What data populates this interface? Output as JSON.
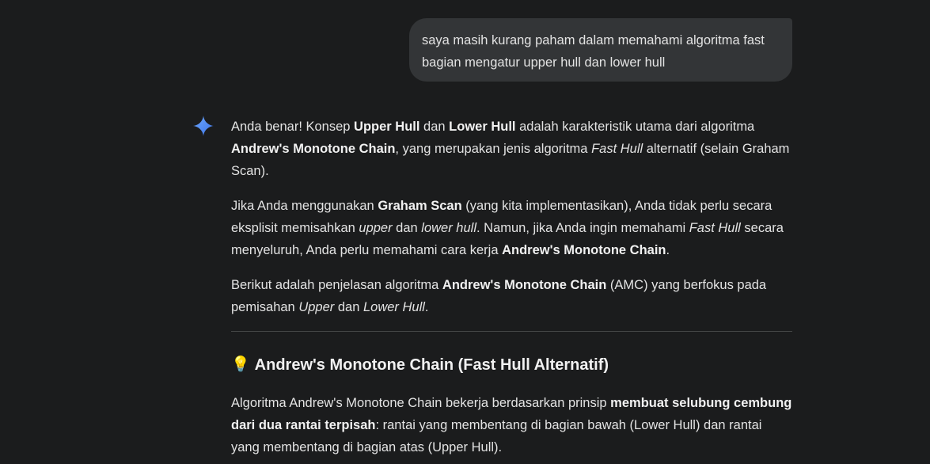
{
  "user_message": {
    "line1": "saya masih kurang paham dalam memahami algoritma fast",
    "line2": "bagian mengatur upper hull dan lower hull"
  },
  "icons": {
    "assistant": "gemini-sparkle-icon",
    "bulb": "💡"
  },
  "response": {
    "p1": {
      "t1": "Anda benar! Konsep ",
      "b1": "Upper Hull",
      "t2": " dan ",
      "b2": "Lower Hull",
      "t3": " adalah karakteristik utama dari algoritma ",
      "b3": "Andrew's Monotone Chain",
      "t4": ", yang merupakan jenis algoritma ",
      "i1": "Fast Hull",
      "t5": " alternatif (selain Graham Scan)."
    },
    "p2": {
      "t1": "Jika Anda menggunakan ",
      "b1": "Graham Scan",
      "t2": " (yang kita implementasikan), Anda tidak perlu secara eksplisit memisahkan ",
      "i1": "upper",
      "t3": " dan ",
      "i2": "lower hull",
      "t4": ". Namun, jika Anda ingin memahami ",
      "i3": "Fast Hull",
      "t5": " secara menyeluruh, Anda perlu memahami cara kerja ",
      "b2": "Andrew's Monotone Chain",
      "t6": "."
    },
    "p3": {
      "t1": "Berikut adalah penjelasan algoritma ",
      "b1": "Andrew's Monotone Chain",
      "t2": " (AMC) yang berfokus pada pemisahan ",
      "i1": "Upper",
      "t3": " dan ",
      "i2": "Lower Hull",
      "t4": "."
    },
    "heading": "Andrew's Monotone Chain (Fast Hull Alternatif)",
    "p4": {
      "t1": "Algoritma Andrew's Monotone Chain bekerja berdasarkan prinsip ",
      "b1": "membuat selubung cembung dari dua rantai terpisah",
      "t2": ": rantai yang membentang di bagian bawah (Lower Hull) dan rantai yang membentang di bagian atas (Upper Hull)."
    }
  },
  "colors": {
    "background": "#1b1c1d",
    "bubble": "#333537",
    "text": "#e3e3e3",
    "sparkle": "#4285f4"
  }
}
